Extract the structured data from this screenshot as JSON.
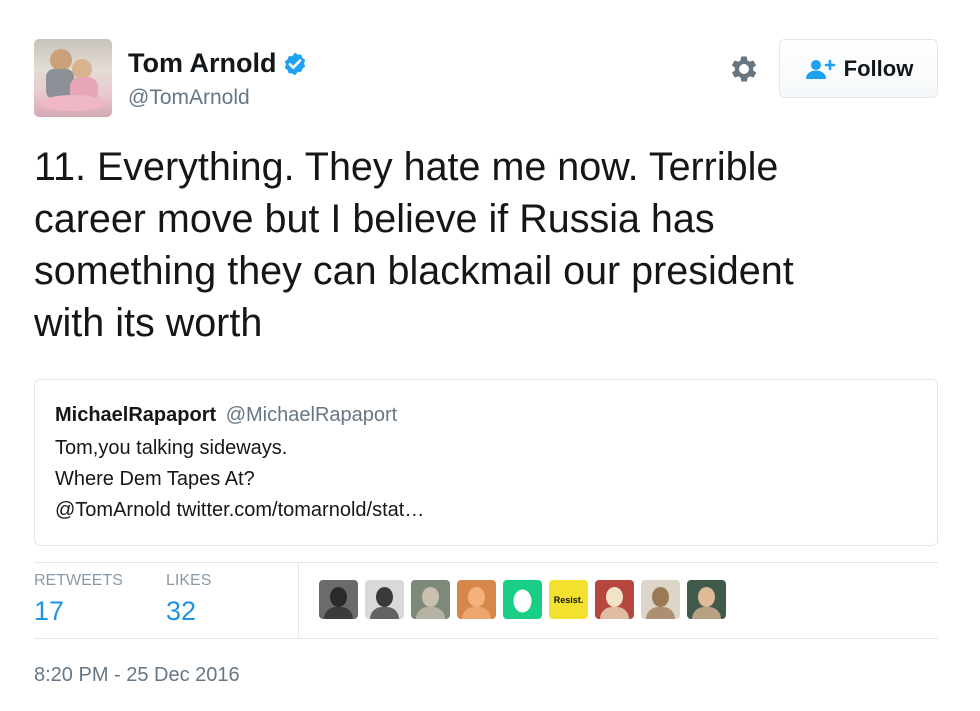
{
  "author": {
    "name": "Tom Arnold",
    "handle": "@TomArnold",
    "verified": true
  },
  "actions": {
    "settings_icon": "gear-icon",
    "follow_label": "Follow",
    "follow_icon": "add-person-icon"
  },
  "tweet": {
    "text": "11. Everything. They hate me now. Terrible\ncareer move but I believe if Russia has\nsomething they can blackmail our president\nwith its worth"
  },
  "quoted_tweet": {
    "name": "MichaelRapaport",
    "handle": "@MichaelRapaport",
    "lines": [
      "Tom,you talking sideways.",
      "Where Dem Tapes At?",
      "@TomArnold twitter.com/tomarnold/stat…"
    ]
  },
  "stats": {
    "retweets_label": "RETWEETS",
    "retweets_count": "17",
    "likes_label": "LIKES",
    "likes_count": "32"
  },
  "likers": [
    {
      "name": "lincoln-avatar",
      "bg": "#6b6b6b",
      "fg": "#2b2b2b",
      "label": ""
    },
    {
      "name": "woman-bw-avatar",
      "bg": "#d9d9d9",
      "fg": "#3a3a3a",
      "label": ""
    },
    {
      "name": "crowd-avatar",
      "bg": "#7d8a7a",
      "fg": "#c9c0b0",
      "label": ""
    },
    {
      "name": "orange-face-avatar",
      "bg": "#d8874b",
      "fg": "#f3b27a",
      "label": ""
    },
    {
      "name": "default-egg-avatar",
      "bg": "#19cf86",
      "fg": "#ffffff",
      "label": ""
    },
    {
      "name": "resist-avatar",
      "bg": "#f2e12e",
      "fg": "#111111",
      "label": "Resist."
    },
    {
      "name": "make-art-avatar",
      "bg": "#b5473f",
      "fg": "#f0e3c8",
      "label": ""
    },
    {
      "name": "poster-avatar",
      "bg": "#ddd6c8",
      "fg": "#9a7a55",
      "label": ""
    },
    {
      "name": "selfie-avatar",
      "bg": "#3f5a4a",
      "fg": "#e0b997",
      "label": ""
    }
  ],
  "timestamp": "8:20 PM - 25 Dec 2016",
  "colors": {
    "link_blue": "#1b95e0",
    "verified_blue": "#1da1f2",
    "muted_gray": "#657786",
    "border_gray": "#e1e8ed"
  }
}
